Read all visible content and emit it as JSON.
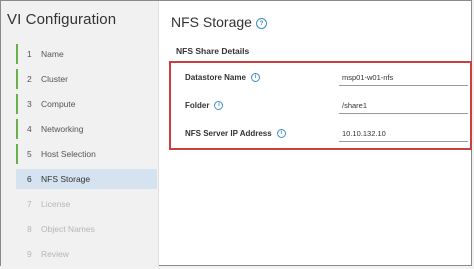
{
  "sidebar": {
    "title": "VI Configuration",
    "steps": [
      {
        "num": "1",
        "label": "Name"
      },
      {
        "num": "2",
        "label": "Cluster"
      },
      {
        "num": "3",
        "label": "Compute"
      },
      {
        "num": "4",
        "label": "Networking"
      },
      {
        "num": "5",
        "label": "Host Selection"
      },
      {
        "num": "6",
        "label": "NFS Storage"
      },
      {
        "num": "7",
        "label": "License"
      },
      {
        "num": "8",
        "label": "Object Names"
      },
      {
        "num": "9",
        "label": "Review"
      }
    ]
  },
  "main": {
    "title": "NFS Storage",
    "section_title": "NFS Share Details",
    "fields": [
      {
        "label": "Datastore Name",
        "value": "msp01-w01-nfs"
      },
      {
        "label": "Folder",
        "value": "/share1"
      },
      {
        "label": "NFS Server IP Address",
        "value": "10.10.132.10"
      }
    ]
  },
  "colors": {
    "completed_step": "#67b04b",
    "active_step_bg": "#d4e3ef",
    "highlight_border": "#c94040",
    "info_icon": "#3d8ec4"
  },
  "icons": {
    "help": "?",
    "info": "i"
  }
}
